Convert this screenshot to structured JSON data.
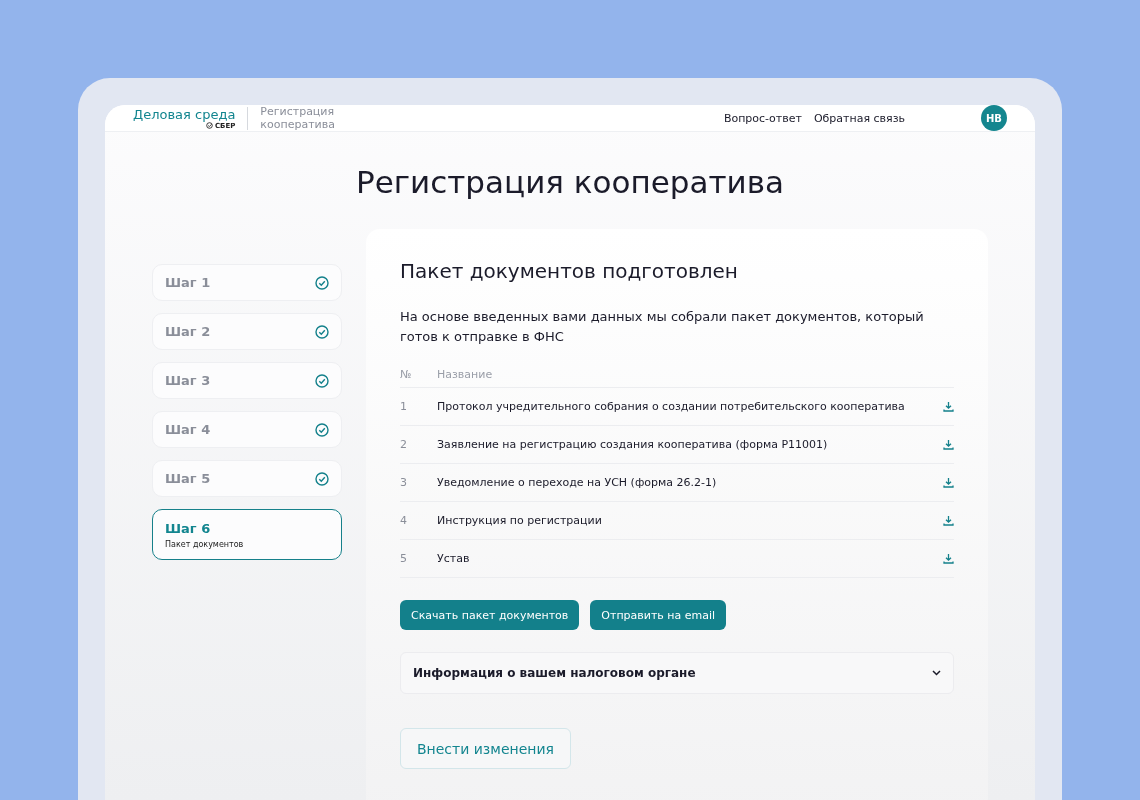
{
  "header": {
    "brand": "Деловая среда",
    "brand_sub": "СБЕР",
    "section": [
      "Регистрация",
      "кооператива"
    ],
    "links": [
      "Вопрос-ответ",
      "Обратная связь"
    ],
    "avatar": "НВ"
  },
  "title": "Регистрация кооператива",
  "steps": [
    {
      "label": "Шаг 1",
      "done": true,
      "selected": false
    },
    {
      "label": "Шаг 2",
      "done": true,
      "selected": false
    },
    {
      "label": "Шаг 3",
      "done": true,
      "selected": false
    },
    {
      "label": "Шаг 4",
      "done": true,
      "selected": false
    },
    {
      "label": "Шаг 5",
      "done": true,
      "selected": false
    },
    {
      "label": "Шаг 6",
      "subtitle": "Пакет документов",
      "done": false,
      "selected": true
    }
  ],
  "card": {
    "heading": "Пакет документов подготовлен",
    "description": "На основе введенных вами данных мы собрали пакет документов, который готов к отправке в ФНС",
    "table": {
      "columns": [
        "№",
        "Название"
      ],
      "rows": [
        {
          "number": "1",
          "name": "Протокол учредительного собрания о создании потребительского кооператива"
        },
        {
          "number": "2",
          "name": "Заявление на регистрацию создания кооператива (форма Р11001)"
        },
        {
          "number": "3",
          "name": "Уведомление о переходе на УСН (форма 26.2-1)"
        },
        {
          "number": "4",
          "name": "Инструкция по регистрации"
        },
        {
          "number": "5",
          "name": "Устав"
        }
      ]
    },
    "buttons": [
      "Скачать пакет документов",
      "Отправить на email"
    ],
    "accordion": {
      "title": "Информация о вашем налоговом органе",
      "expanded": false
    },
    "edit_button": "Внести изменения"
  }
}
